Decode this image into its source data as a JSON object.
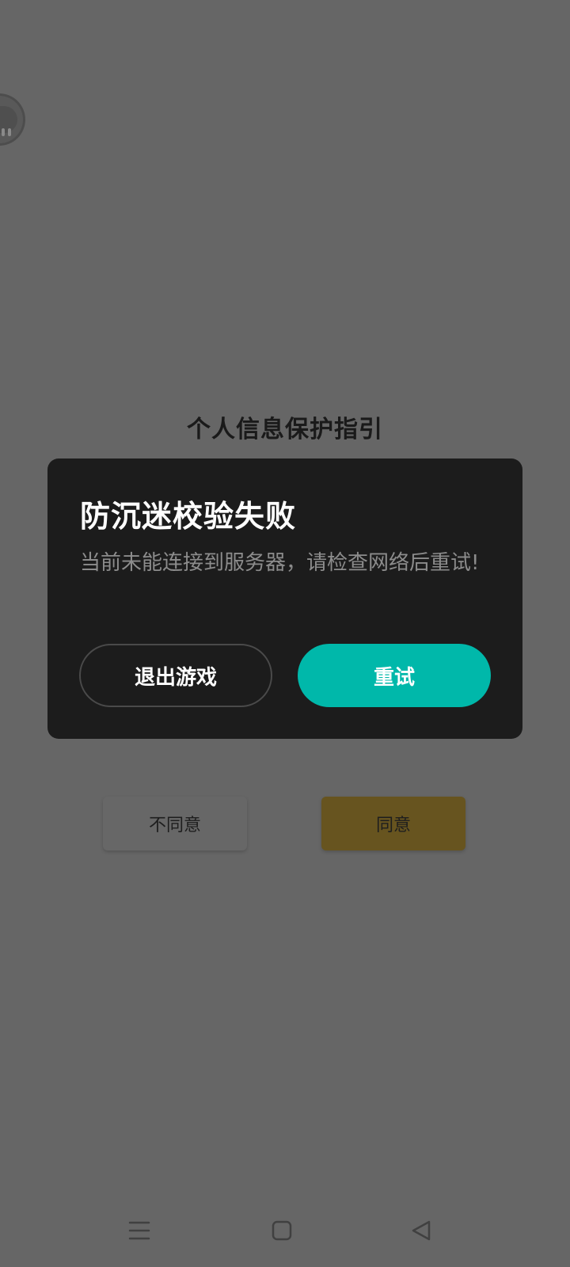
{
  "background_screen": {
    "guide_title": "个人信息保护指引",
    "disagree_label": "不同意",
    "agree_label": "同意"
  },
  "dialog": {
    "title": "防沉迷校验失败",
    "message": "当前未能连接到服务器，请检查网络后重试!",
    "exit_label": "退出游戏",
    "retry_label": "重试"
  },
  "floating_assistant": {
    "icon": "assistant-bubble-icon"
  },
  "navbar": {
    "menu_icon": "menu-icon",
    "home_icon": "home-square-icon",
    "back_icon": "back-triangle-icon"
  },
  "colors": {
    "overlay_bg": "#666666",
    "dialog_bg": "#1c1c1c",
    "accent": "#00b8aa",
    "agree_button_dimmed": "#67541f"
  }
}
